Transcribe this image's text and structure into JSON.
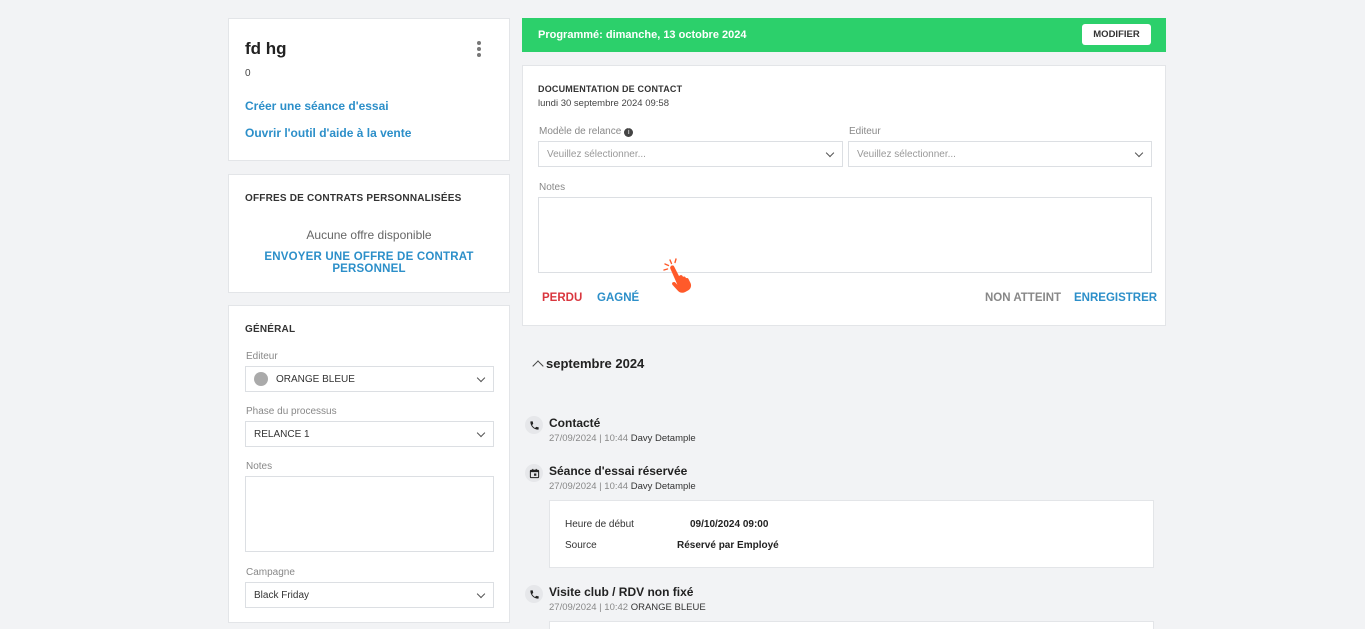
{
  "profile": {
    "name": "fd hg",
    "sub": "0",
    "link_trial": "Créer une séance d'essai",
    "link_sales": "Ouvrir l'outil d'aide à la vente"
  },
  "offers": {
    "title": "OFFRES DE CONTRATS PERSONNALISÉES",
    "empty": "Aucune offre disponible",
    "send": "ENVOYER UNE OFFRE DE CONTRAT PERSONNEL"
  },
  "general": {
    "title": "GÉNÉRAL",
    "editor_label": "Editeur",
    "editor_value": "ORANGE BLEUE",
    "phase_label": "Phase du processus",
    "phase_value": "RELANCE 1",
    "notes_label": "Notes",
    "campaign_label": "Campagne",
    "campaign_value": "Black Friday"
  },
  "schedule": {
    "text": "Programmé: dimanche, 13 octobre 2024",
    "button": "MODIFIER",
    "color": "#2cd06b"
  },
  "contact": {
    "title": "DOCUMENTATION DE CONTACT",
    "date": "lundi 30 septembre 2024 09:58",
    "template_label": "Modèle de relance",
    "template_placeholder": "Veuillez sélectionner...",
    "editor_label": "Editeur",
    "editor_placeholder": "Veuillez sélectionner...",
    "notes_label": "Notes",
    "lost": "PERDU",
    "won": "GAGNÉ",
    "not_reached": "NON ATTEINT",
    "save": "ENREGISTRER"
  },
  "timeline": {
    "month": "septembre 2024",
    "entries": [
      {
        "icon": "phone-icon",
        "title": "Contacté",
        "meta": "27/09/2024 | 10:44",
        "author": "Davy Detample"
      },
      {
        "icon": "calendar-icon",
        "title": "Séance d'essai réservée",
        "meta": "27/09/2024 | 10:44",
        "author": "Davy Detample",
        "details": [
          {
            "key": "Heure de début",
            "value": "09/10/2024 09:00"
          },
          {
            "key": "Source",
            "value": "Réservé par Employé"
          }
        ]
      },
      {
        "icon": "phone-icon",
        "title": "Visite club / RDV non fixé",
        "meta": "27/09/2024 | 10:42",
        "author": "ORANGE BLEUE"
      }
    ]
  },
  "colors": {
    "link": "#2c8fc9",
    "danger": "#d9363e",
    "muted": "#888888"
  }
}
